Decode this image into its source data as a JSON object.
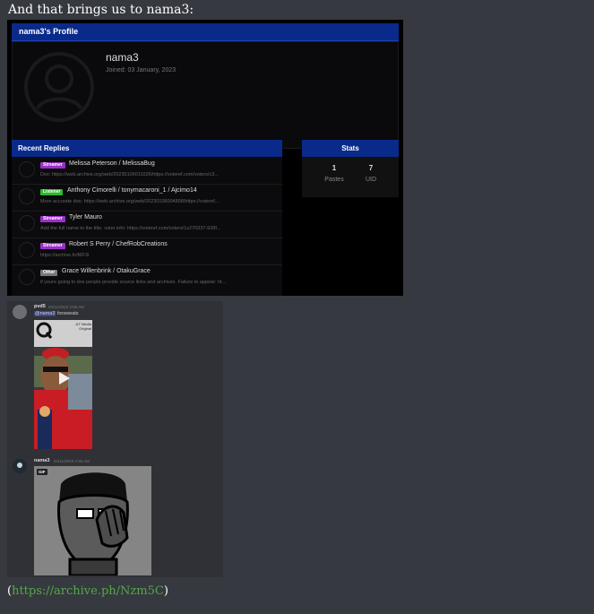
{
  "intro_text": "And that brings us to nama3:",
  "profile": {
    "title": "nama3's Profile",
    "username": "nama3",
    "joined": "Joined: 03 January, 2023"
  },
  "recent_replies": {
    "title": "Recent Replies",
    "items": [
      {
        "badge": "Streamer",
        "badge_color": "#9b30c9",
        "name": "Melissa Peterson / MelissaBug",
        "text": "Dox: https://web.archive.org/web/20230106011026/https://voteref.com/voters/c3..."
      },
      {
        "badge": "Listener",
        "badge_color": "#2db82d",
        "name": "Anthony Cimorelli / tonymacaroni_1 / Ajcimo14",
        "text": "More accurate dox: https://web.archive.org/web/20230106004808/https://voteref...."
      },
      {
        "badge": "Streamer",
        "badge_color": "#9b30c9",
        "name": "Tyler Mauro",
        "text": "Add the full name to the title. voter info: https://voteref.com/voters/1s270337-928f..."
      },
      {
        "badge": "Streamer",
        "badge_color": "#9b30c9",
        "name": "Robert S Perry / ChefRobCreations",
        "text": "https://archive.fo/MF3i"
      },
      {
        "badge": "Other",
        "badge_color": "#777777",
        "name": "Grace Willenbrink / OtakuGrace",
        "text": "if youre going to dox people provide source links and archives. Failure to appear: ht..."
      }
    ]
  },
  "stats": {
    "title": "Stats",
    "pastes_value": "1",
    "pastes_label": "Pastes",
    "uid_value": "7",
    "uid_label": "UID"
  },
  "discord": {
    "msg1": {
      "user": "pvd5",
      "time": "04/11/2023 2:55 AM",
      "mention": "@nama3",
      "text": "forsweats",
      "video_top_text": "JLT Media Original"
    },
    "msg2": {
      "user": "nama3",
      "time": "04/11/2023 2:55 AM",
      "gif_label": "GIF"
    }
  },
  "link": {
    "open": "(",
    "url": "https://archive.ph/Nzm5C",
    "close": ")"
  }
}
